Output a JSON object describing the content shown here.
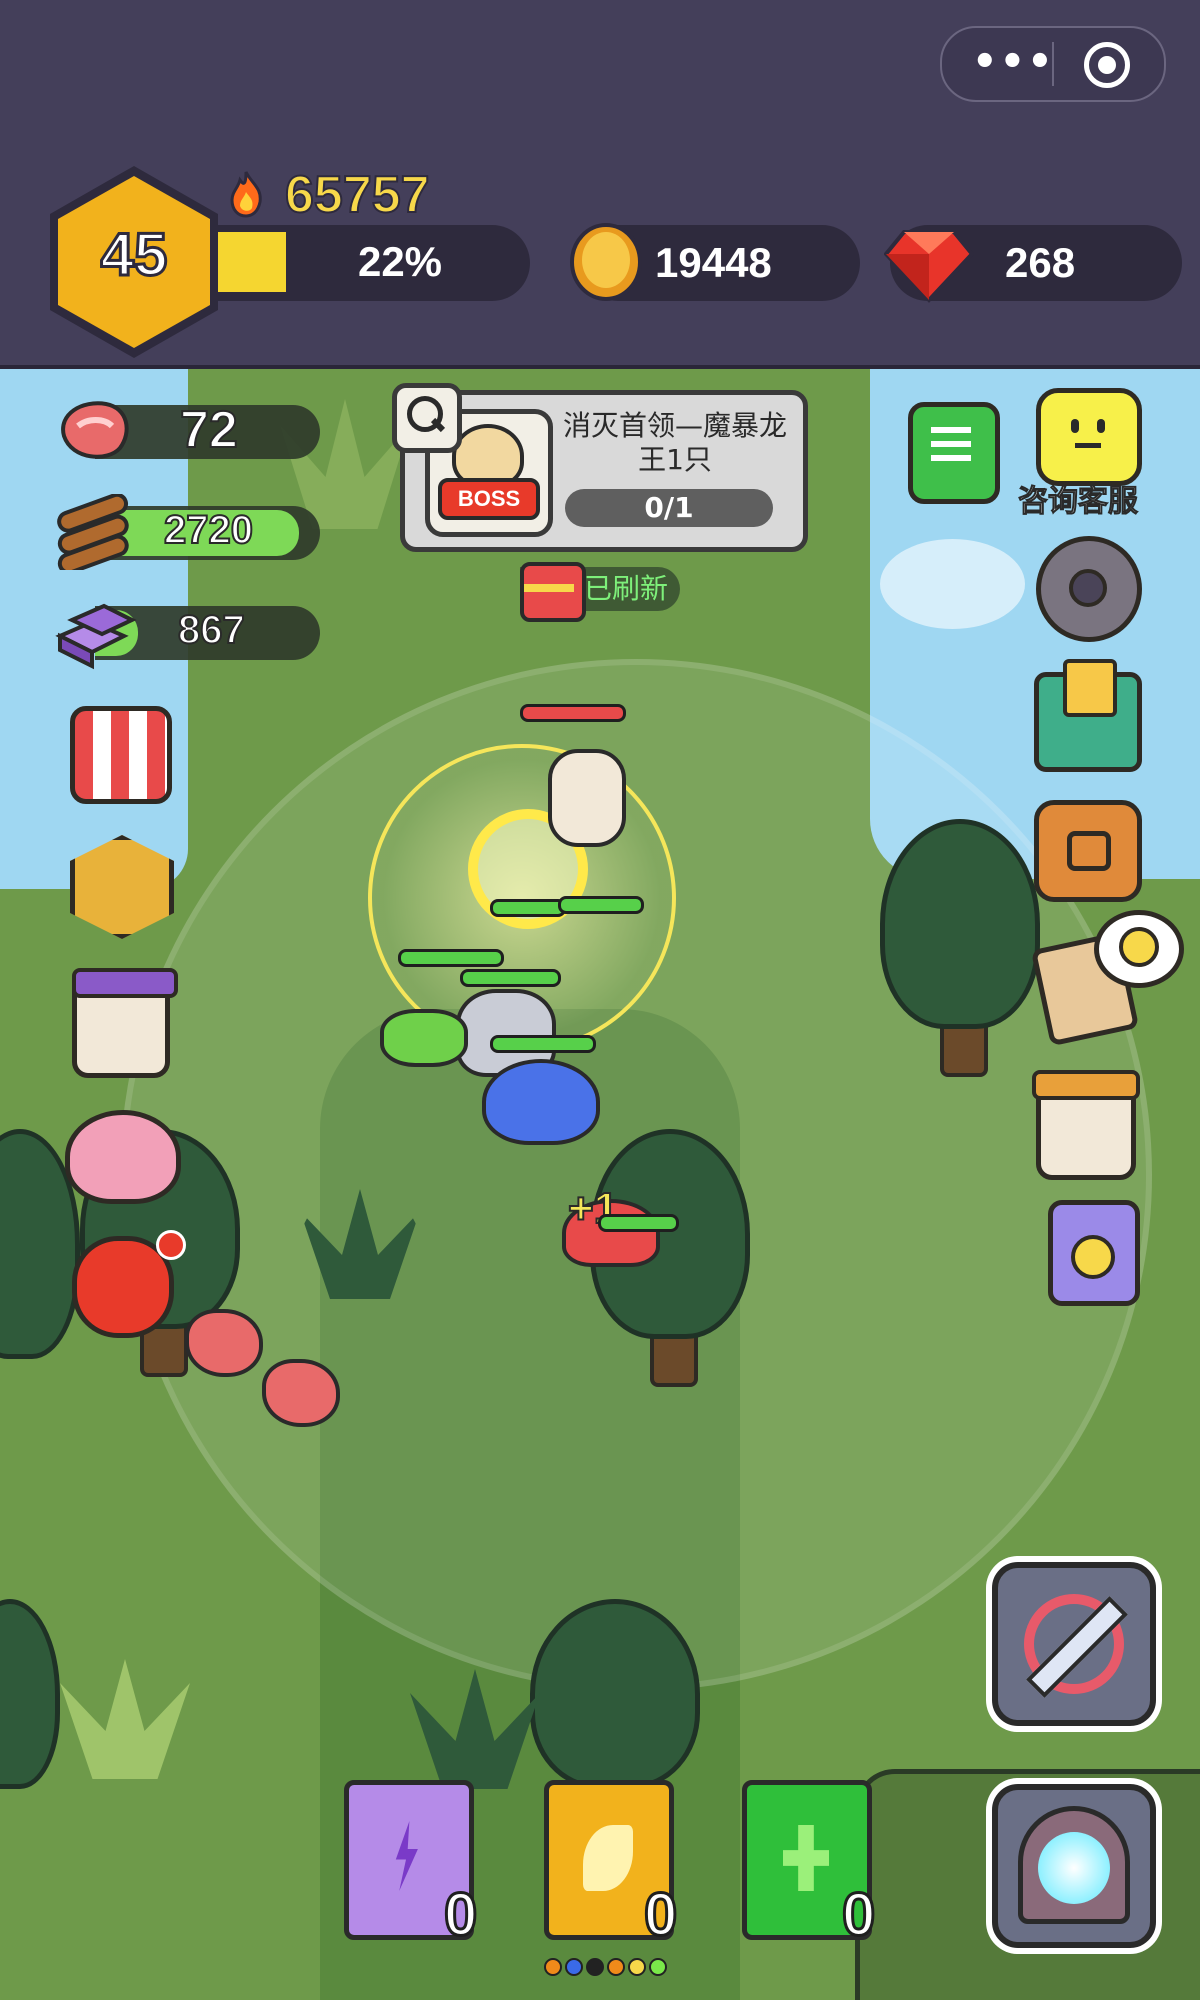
{
  "top_bar": {
    "level": "45",
    "power": "65757",
    "xp_percent_label": "22%",
    "xp_fraction": 0.22,
    "coins": "19448",
    "gems": "268"
  },
  "resources": {
    "meat": "72",
    "wood": "2720",
    "ore": "867",
    "wood_fill_fraction": 0.95,
    "ore_fill_fraction": 0.2
  },
  "quest": {
    "title": "消灭首领—魔暴龙王1只",
    "progress": "0/1",
    "boss_badge": "BOSS"
  },
  "chest_status": "已刷新",
  "customer_service_label": "咨询客服",
  "floating_text": "+1",
  "spell_books": [
    {
      "name": "lightning-book",
      "count": "0",
      "color": "#b58be8"
    },
    {
      "name": "wing-book",
      "count": "0",
      "color": "#f2b21c"
    },
    {
      "name": "heal-book",
      "count": "0",
      "color": "#2fbf3a"
    }
  ],
  "colors": {
    "header_bg": "#443f5a",
    "grass": "#6e9a4a",
    "water": "#9fd7f2",
    "xp_fill": "#f5d630",
    "hp_green": "#57d04a"
  }
}
